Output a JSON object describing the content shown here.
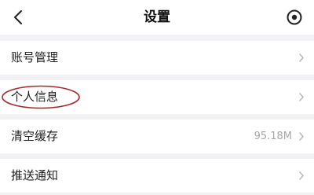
{
  "header": {
    "title": "设置",
    "back_icon": "chevron-left-icon",
    "action_icon": "scan-icon"
  },
  "settings": {
    "items": [
      {
        "label": "账号管理",
        "value": ""
      },
      {
        "label": "个人信息",
        "value": "",
        "highlighted": true
      },
      {
        "label": "清空缓存",
        "value": "95.18M"
      },
      {
        "label": "推送通知",
        "value": ""
      }
    ]
  },
  "colors": {
    "page_bg": "#f2f2f4",
    "card_bg": "#ffffff",
    "highlight_ellipse": "#a3292c"
  }
}
